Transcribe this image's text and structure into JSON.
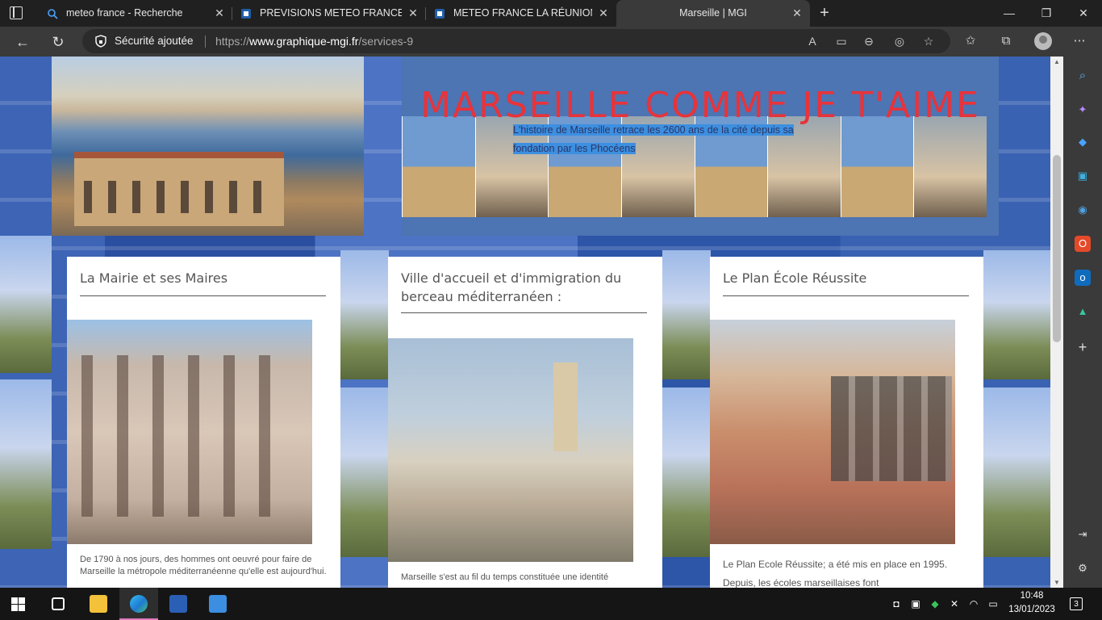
{
  "browser": {
    "tabs": [
      {
        "title": "meteo france - Recherche",
        "favicon": "search-icon",
        "active": false
      },
      {
        "title": "PREVISIONS METEO FRANCE - Si",
        "favicon": "meteo-site-icon",
        "active": false
      },
      {
        "title": "METEO FRANCE LA RÉUNION pa",
        "favicon": "meteo-site-icon",
        "active": false
      },
      {
        "title": "Marseille | MGI",
        "favicon": "",
        "active": true
      }
    ],
    "security_label": "Sécurité ajoutée",
    "url_prefix": "https://",
    "url_domain": "www.graphique-mgi.fr",
    "url_path": "/services-9"
  },
  "page": {
    "site_title": "MARSEILLE COMME JE T'AIME",
    "site_subtitle_line1": "L'histoire de Marseille retrace les 2600 ans de la cité depuis sa",
    "site_subtitle_line2": "fondation par les Phocéens",
    "cards": [
      {
        "title": "La Mairie et ses Maires",
        "text": "De 1790 à nos jours, des hommes ont oeuvré pour faire de Marseille la métropole méditerranéenne qu'elle est aujourd'hui."
      },
      {
        "title": "Ville d'accueil et d'immigration du berceau méditerranéen :",
        "text": "Marseille s'est au fil du temps constituée une identité"
      },
      {
        "title": "Le Plan École Réussite",
        "text": "Le Plan Ecole Réussite; a été mis en place en 1995. Depuis, les écoles marseillaises font"
      }
    ]
  },
  "taskbar": {
    "time": "10:48",
    "date": "13/01/2023",
    "notification_count": "3"
  },
  "colors": {
    "title_red": "#e8333a",
    "highlight_blue": "#3d8fe0",
    "active_tab_underline": "#e07ac0"
  }
}
